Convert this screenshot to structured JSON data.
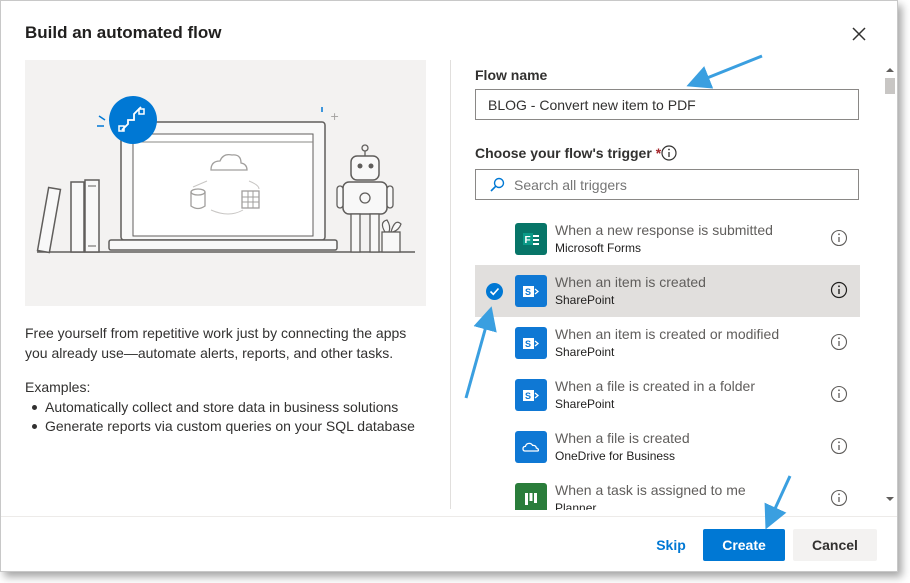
{
  "dialog": {
    "title": "Build an automated flow",
    "description": "Free yourself from repetitive work just by connecting the apps you already use—automate alerts, reports, and other tasks.",
    "examples_title": "Examples:",
    "examples": [
      "Automatically collect and store data in business solutions",
      "Generate reports via custom queries on your SQL database"
    ]
  },
  "form": {
    "flow_name_label": "Flow name",
    "flow_name_value": "BLOG - Convert new item to PDF",
    "trigger_label": "Choose your flow's trigger",
    "required_mark": "*",
    "search_placeholder": "Search all triggers"
  },
  "triggers": [
    {
      "name": "When a new response is submitted",
      "app": "Microsoft Forms",
      "icon": "forms-icon",
      "color": "#077568"
    },
    {
      "name": "When an item is created",
      "app": "SharePoint",
      "icon": "sharepoint-icon",
      "color": "#0f78d4",
      "selected": true
    },
    {
      "name": "When an item is created or modified",
      "app": "SharePoint",
      "icon": "sharepoint-icon",
      "color": "#0f78d4"
    },
    {
      "name": "When a file is created in a folder",
      "app": "SharePoint",
      "icon": "sharepoint-icon",
      "color": "#0f78d4"
    },
    {
      "name": "When a file is created",
      "app": "OneDrive for Business",
      "icon": "onedrive-icon",
      "color": "#0f78d4"
    },
    {
      "name": "When a task is assigned to me",
      "app": "Planner",
      "icon": "planner-icon",
      "color": "#2a7d3b"
    }
  ],
  "buttons": {
    "skip": "Skip",
    "create": "Create",
    "cancel": "Cancel"
  },
  "colors": {
    "primary": "#0078d4",
    "annotation_arrow": "#3a9fe0"
  }
}
